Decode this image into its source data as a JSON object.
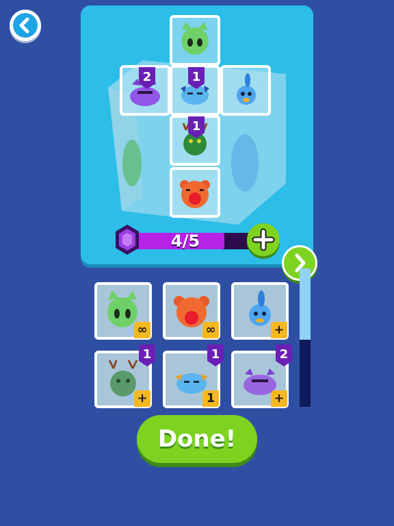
{
  "colors": {
    "background": "#2f4fa3",
    "panel": "#2cbde8",
    "accent_green": "#7ed321",
    "energy_purple": "#b622e6",
    "count_badge": "#f5b820",
    "level_badge": "#6a1fb5"
  },
  "energy": {
    "label": "4/5",
    "current": 4,
    "max": 5
  },
  "dice_faces": [
    {
      "id": "cat",
      "icon": "green-cat-monster-icon",
      "level": ""
    },
    {
      "id": "purple",
      "icon": "purple-horned-monster-icon",
      "level": "2"
    },
    {
      "id": "blue-bull",
      "icon": "blue-bull-monster-icon",
      "level": "1"
    },
    {
      "id": "blue-bird",
      "icon": "blue-bird-monster-icon",
      "level": ""
    },
    {
      "id": "deer",
      "icon": "green-deer-monster-icon",
      "level": "1"
    },
    {
      "id": "bear",
      "icon": "red-bear-monster-icon",
      "level": ""
    }
  ],
  "inventory": [
    {
      "icon": "green-cat-monster-icon",
      "level": "",
      "count": "∞"
    },
    {
      "icon": "red-bear-monster-icon",
      "level": "",
      "count": "∞"
    },
    {
      "icon": "blue-bird-monster-icon",
      "level": "",
      "count": "+"
    },
    {
      "icon": "green-deer-monster-icon",
      "level": "1",
      "count": "+"
    },
    {
      "icon": "blue-bull-monster-icon",
      "level": "1",
      "count": "1"
    },
    {
      "icon": "purple-horned-monster-icon",
      "level": "2",
      "count": "+"
    }
  ],
  "buttons": {
    "done": "Done!"
  }
}
